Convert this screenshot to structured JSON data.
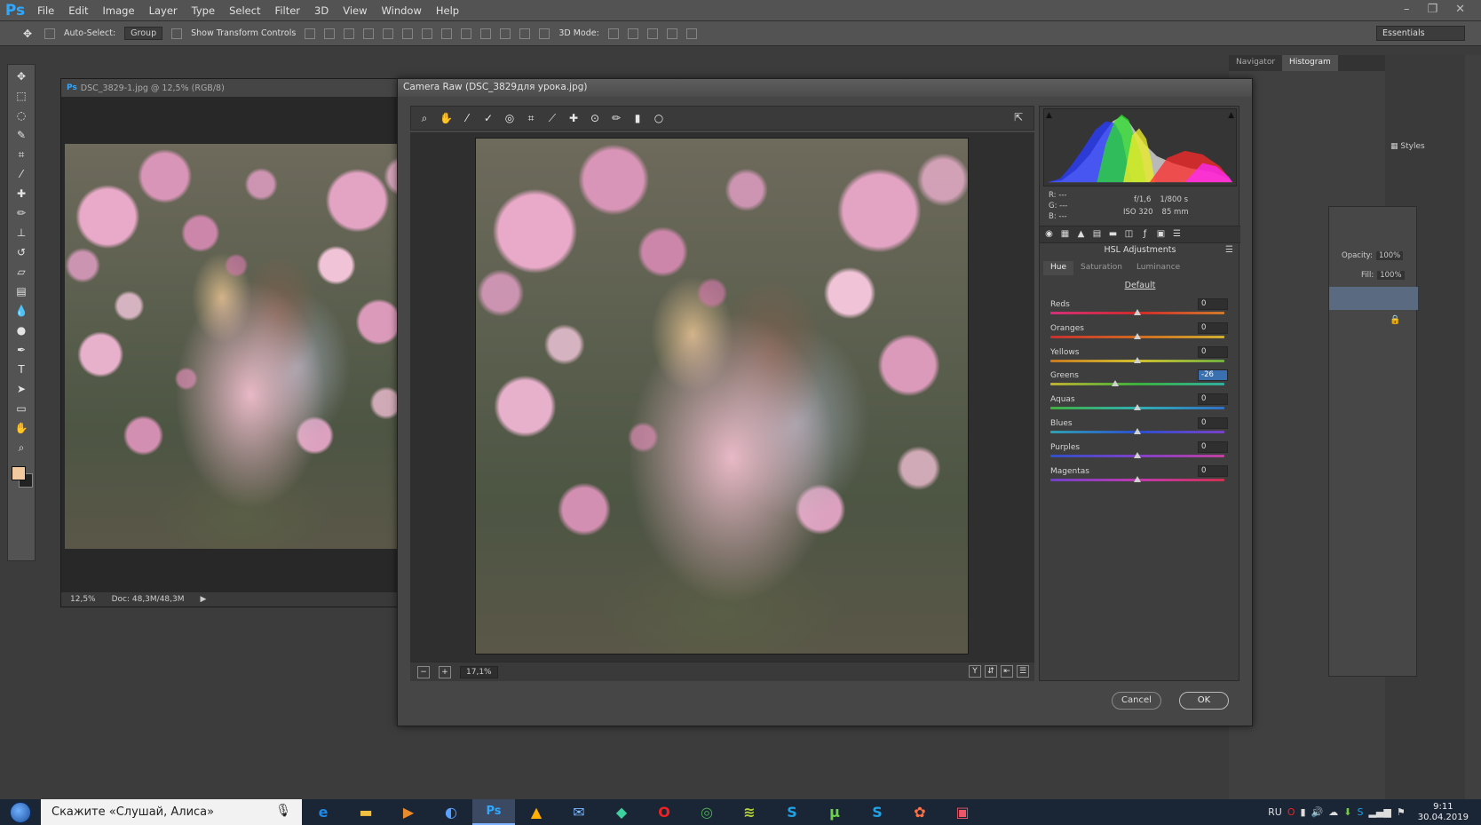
{
  "app": {
    "logo": "Ps",
    "menu": [
      "File",
      "Edit",
      "Image",
      "Layer",
      "Type",
      "Select",
      "Filter",
      "3D",
      "View",
      "Window",
      "Help"
    ]
  },
  "options_bar": {
    "auto_select_label": "Auto-Select:",
    "auto_select_value": "Group",
    "show_transform_label": "Show Transform Controls",
    "mode_3d_label": "3D Mode:",
    "workspace": "Essentials"
  },
  "document": {
    "tab_title": "DSC_3829-1.jpg @ 12,5% (RGB/8)",
    "zoom": "12,5%",
    "doc_size": "Doc: 48,3M/48,3M"
  },
  "right_dock": {
    "tabs": [
      "Navigator",
      "Histogram"
    ],
    "active_tab": "Histogram",
    "side_items": [
      "Styles"
    ],
    "opacity_label": "Opacity:",
    "opacity_value": "100%",
    "fill_label": "Fill:",
    "fill_value": "100%"
  },
  "camera_raw": {
    "title": "Camera Raw (DSC_3829для урока.jpg)",
    "rgb_labels": {
      "r": "R:",
      "g": "G:",
      "b": "B:"
    },
    "rgb_values": {
      "r": "---",
      "g": "---",
      "b": "---"
    },
    "aperture": "f/1,6",
    "shutter": "1/800 s",
    "iso": "ISO 320",
    "focal": "85 mm",
    "zoom": "17,1%",
    "panel_title": "HSL Adjustments",
    "tabs": [
      "Hue",
      "Saturation",
      "Luminance"
    ],
    "active_tab": "Hue",
    "default_link": "Default",
    "sliders": [
      {
        "label": "Reds",
        "value": "0",
        "pos": 0.5,
        "selected": false
      },
      {
        "label": "Oranges",
        "value": "0",
        "pos": 0.5,
        "selected": false
      },
      {
        "label": "Yellows",
        "value": "0",
        "pos": 0.5,
        "selected": false
      },
      {
        "label": "Greens",
        "value": "-26",
        "pos": 0.37,
        "selected": true
      },
      {
        "label": "Aquas",
        "value": "0",
        "pos": 0.5,
        "selected": false
      },
      {
        "label": "Blues",
        "value": "0",
        "pos": 0.5,
        "selected": false
      },
      {
        "label": "Purples",
        "value": "0",
        "pos": 0.5,
        "selected": false
      },
      {
        "label": "Magentas",
        "value": "0",
        "pos": 0.5,
        "selected": false
      }
    ],
    "cancel_label": "Cancel",
    "ok_label": "OK"
  },
  "taskbar": {
    "search_text": "Скажите «Слушай, Алиса»",
    "language": "RU",
    "time": "9:11",
    "date": "30.04.2019"
  }
}
